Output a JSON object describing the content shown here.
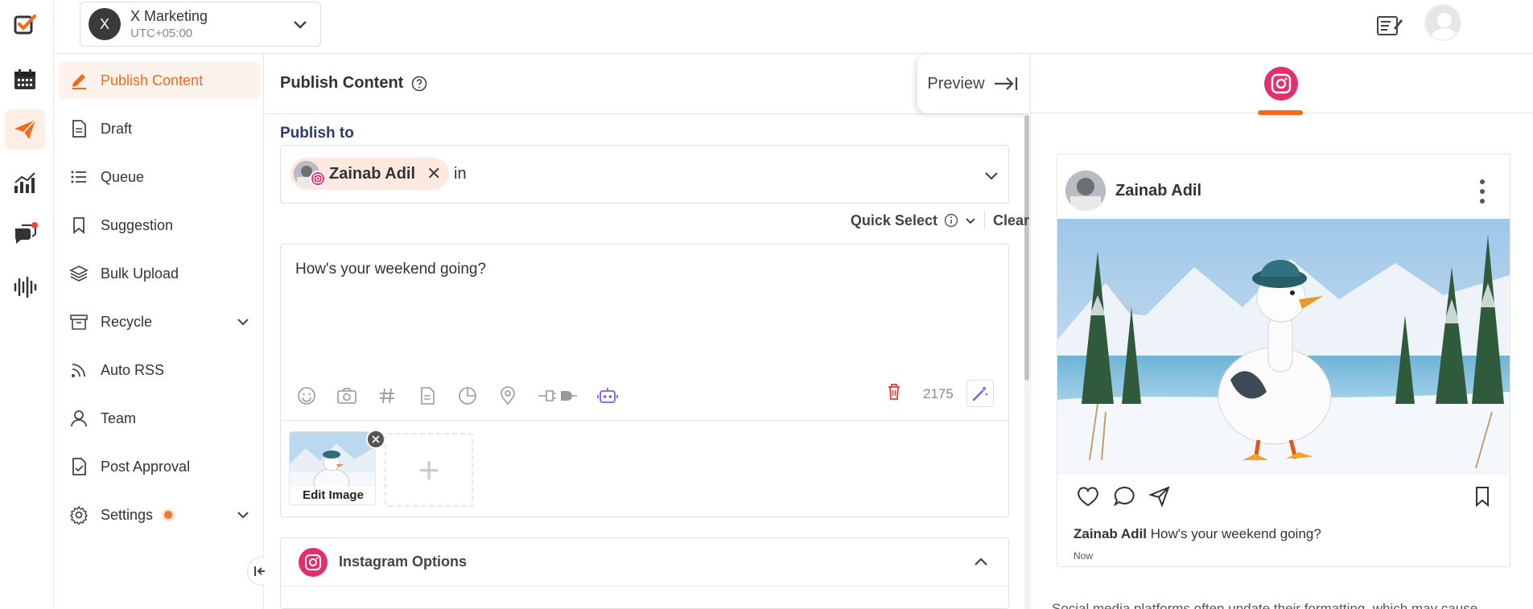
{
  "app": {
    "workspace": {
      "initial": "X",
      "name": "X Marketing",
      "timezone": "UTC+05:00"
    }
  },
  "rail": [
    "logo-icon",
    "calendar-icon",
    "send-icon",
    "analytics-icon",
    "chat-icon",
    "audio-icon"
  ],
  "subnav": {
    "items": [
      {
        "label": "Publish Content",
        "icon": "pencil-icon",
        "active": true
      },
      {
        "label": "Draft",
        "icon": "document-icon"
      },
      {
        "label": "Queue",
        "icon": "list-icon"
      },
      {
        "label": "Suggestion",
        "icon": "bookmark-icon"
      },
      {
        "label": "Bulk Upload",
        "icon": "layers-icon"
      },
      {
        "label": "Recycle",
        "icon": "archive-icon",
        "expandable": true
      },
      {
        "label": "Auto RSS",
        "icon": "rss-icon"
      },
      {
        "label": "Team",
        "icon": "user-icon"
      },
      {
        "label": "Post Approval",
        "icon": "approval-icon"
      },
      {
        "label": "Settings",
        "icon": "gear-icon",
        "expandable": true,
        "badge": true
      }
    ]
  },
  "composer": {
    "title": "Publish Content",
    "preview_label": "Preview",
    "publish_to_label": "Publish to",
    "account_chip": {
      "name": "Zainab Adil",
      "network": "instagram"
    },
    "account_input_value": "in",
    "quick_select_label": "Quick Select",
    "clear_label": "Clear",
    "editor_text": "How's your weekend going?",
    "char_count": "2175",
    "media": {
      "edit_label": "Edit Image",
      "add_label": "+"
    },
    "instagram_options_label": "Instagram Options"
  },
  "preview": {
    "account_name": "Zainab Adil",
    "caption_user": "Zainab Adil",
    "caption_text": "How's your weekend going?",
    "time": "Now",
    "note": "Social media platforms often update their formatting, which may cause"
  },
  "colors": {
    "accent": "#f26a1b",
    "instagram": "#e1306c",
    "navy": "#2b3b6e"
  }
}
